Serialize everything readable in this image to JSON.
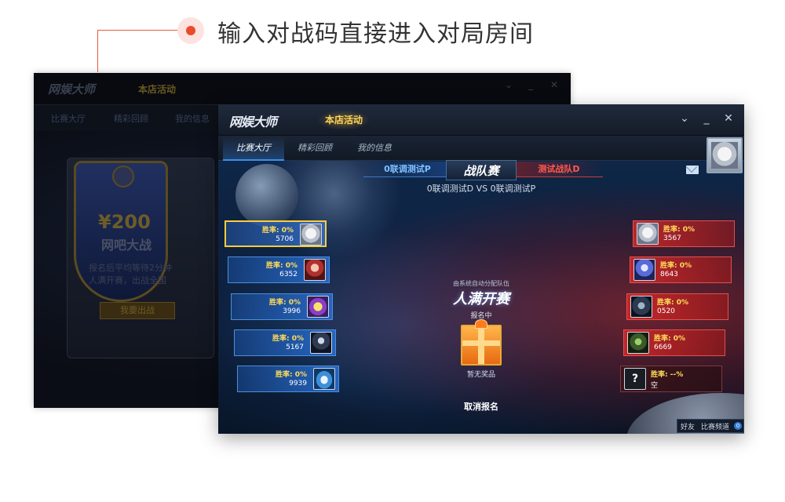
{
  "caption": {
    "text": "输入对战码直接进入对局房间",
    "accent_color": "#ea4b2c"
  },
  "back_window": {
    "logo": "网娱大师",
    "promo_badge": "本店活动",
    "nav": [
      "比赛大厅",
      "精彩回顾",
      "我的信息"
    ],
    "card": {
      "price": "¥200",
      "title": "网吧大战",
      "desc_line1": "报名后平均等待2分钟",
      "desc_line2": "人满开赛，出战全国",
      "button": "我要出战"
    }
  },
  "window": {
    "logo": "网娱大师",
    "promo_badge": "本店活动",
    "controls": {
      "collapse_icon": "chevron-down-icon",
      "minimize_icon": "minimize-icon",
      "close_icon": "close-icon"
    },
    "nav": {
      "tabs": [
        {
          "label": "比赛大厅",
          "active": true
        },
        {
          "label": "精彩回顾",
          "active": false
        },
        {
          "label": "我的信息",
          "active": false
        }
      ]
    }
  },
  "match": {
    "team_left": "0联调测试P",
    "title": "战队赛",
    "team_right": "测试战队D",
    "matchup": "0联调测试D VS 0联调测试P",
    "center_note": "由系统自动分配队伍",
    "center_title": "人满开赛",
    "status": "报名中",
    "reward_label": "暂无奖品",
    "cancel_label": "取消报名",
    "left_team_color": "#3c8ef0",
    "right_team_color": "#d83a3a"
  },
  "left_players": [
    {
      "rate": "胜率: 0%",
      "score": "5706"
    },
    {
      "rate": "胜率: 0%",
      "score": "6352"
    },
    {
      "rate": "胜率: 0%",
      "score": "3996"
    },
    {
      "rate": "胜率: 0%",
      "score": "5167"
    },
    {
      "rate": "胜率: 0%",
      "score": "9939"
    }
  ],
  "right_players": [
    {
      "rate": "胜率: 0%",
      "score": "3567"
    },
    {
      "rate": "胜率: 0%",
      "score": "8643"
    },
    {
      "rate": "胜率: 0%",
      "score": "0520"
    },
    {
      "rate": "胜率: 0%",
      "score": "6669"
    },
    {
      "rate": "胜率: --%",
      "score": "空"
    }
  ],
  "chat": {
    "friends": "好友",
    "channel": "比赛频道",
    "count": "0"
  }
}
